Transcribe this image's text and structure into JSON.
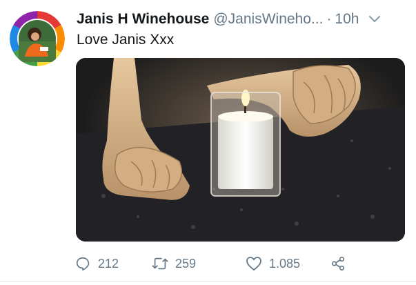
{
  "tweet": {
    "display_name": "Janis H Winehouse",
    "handle": "@JanisWineho...",
    "separator": "·",
    "time": "10h",
    "text": "Love Janis Xxx",
    "avatar_icon": "rainbow-profile-avatar",
    "media_icon": "shoes-and-candle-photo"
  },
  "actions": {
    "reply": {
      "icon": "reply-icon",
      "count": "212"
    },
    "retweet": {
      "icon": "retweet-icon",
      "count": "259"
    },
    "like": {
      "icon": "heart-icon",
      "count": "1.085"
    },
    "share": {
      "icon": "share-icon"
    }
  },
  "colors": {
    "text_primary": "#14171a",
    "text_secondary": "#657786",
    "border": "#e1e8ed"
  }
}
